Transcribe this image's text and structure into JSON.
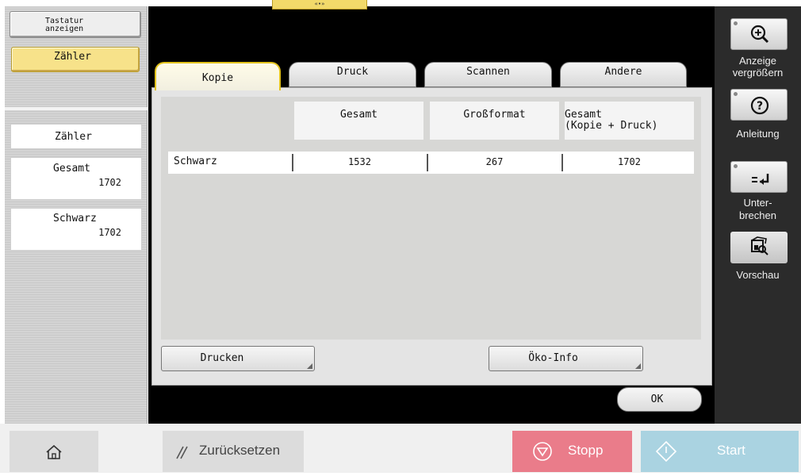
{
  "top_tab": {
    "label": "«•»"
  },
  "left": {
    "keyboard_btn": {
      "line1": "Tastatur",
      "line2": "anzeigen"
    },
    "counter_btn": {
      "label": "Zähler"
    },
    "section_title": "Zähler",
    "counters": [
      {
        "label": "Gesamt",
        "value": "1702"
      },
      {
        "label": "Schwarz",
        "value": "1702"
      }
    ]
  },
  "tabs": [
    {
      "label": "Kopie",
      "active": true
    },
    {
      "label": "Druck",
      "active": false
    },
    {
      "label": "Scannen",
      "active": false
    },
    {
      "label": "Andere",
      "active": false
    }
  ],
  "table": {
    "headers": [
      {
        "line1": "Gesamt",
        "line2": ""
      },
      {
        "line1": "Großformat",
        "line2": ""
      },
      {
        "line1": "Gesamt",
        "line2": "(Kopie + Druck)"
      }
    ],
    "rows": [
      {
        "label": "Schwarz",
        "values": [
          "1532",
          "267",
          "1702"
        ]
      }
    ]
  },
  "buttons": {
    "print": "Drucken",
    "eco": "Öko-Info",
    "ok": "OK"
  },
  "right": {
    "zoom": {
      "line1": "Anzeige",
      "line2": "vergrößern",
      "icon": "zoom-in-icon"
    },
    "guide": {
      "line1": "Anleitung",
      "icon": "help-icon"
    },
    "interrupt": {
      "line1": "Unter-",
      "line2": "brechen",
      "icon": "interrupt-icon"
    },
    "preview": {
      "line1": "Vorschau",
      "icon": "preview-icon"
    }
  },
  "bottom": {
    "home_icon": "home-icon",
    "reset": "Zurücksetzen",
    "stop": "Stopp",
    "start": "Start"
  },
  "colors": {
    "active_yellow": "#f7e28a",
    "stop": "#ea7c8a",
    "start": "#aad3e1"
  }
}
